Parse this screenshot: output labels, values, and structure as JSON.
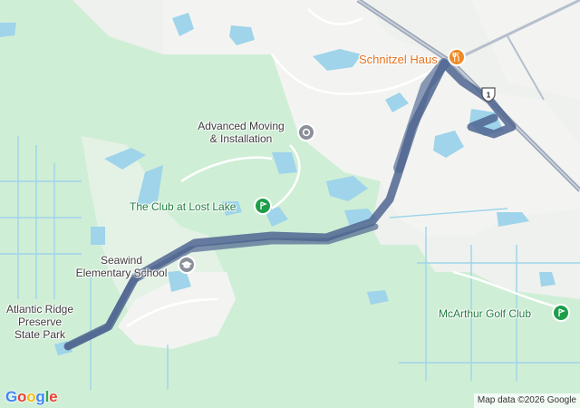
{
  "map": {
    "labels": {
      "schnitzel": "Schnitzel Haus",
      "advanced_line1": "Advanced Moving",
      "advanced_line2": "& Installation",
      "club": "The Club at Lost Lake",
      "seawind_line1": "Seawind",
      "seawind_line2": "Elementary School",
      "atlantic_line1": "Atlantic Ridge",
      "atlantic_line2": "Preserve",
      "atlantic_line3": "State Park",
      "mcarthur": "McArthur Golf Club"
    },
    "highway_shield": "1",
    "attribution": "Map data ©2026 Google",
    "logo": [
      "G",
      "o",
      "o",
      "g",
      "l",
      "e"
    ],
    "colors": {
      "land": "#eef1ee",
      "park": "#cfeed6",
      "water": "#9fd4ea",
      "route": "#4f6590",
      "road_major": "#9aa4b5",
      "poi_orange": "#f08a24",
      "poi_green": "#1e9e4a",
      "poi_gray": "#8a8f99"
    },
    "icons": {
      "restaurant": "fork-knife-icon",
      "golf": "golf-flag-icon",
      "school": "graduation-cap-icon",
      "business": "circle-pin-icon"
    }
  }
}
